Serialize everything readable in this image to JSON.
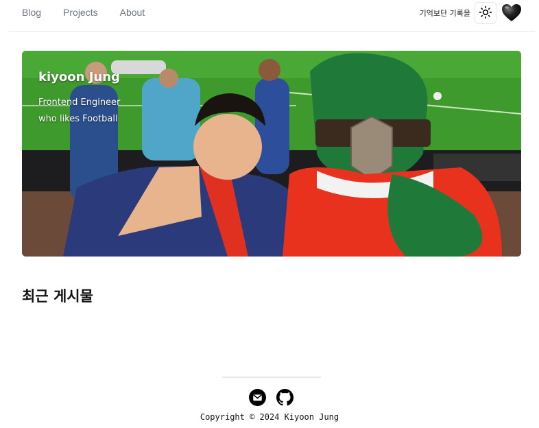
{
  "nav": {
    "items": [
      {
        "label": "Blog"
      },
      {
        "label": "Projects"
      },
      {
        "label": "About"
      }
    ]
  },
  "header": {
    "tagline": "기억보단 기록을"
  },
  "hero": {
    "name": "kiyoon Jung",
    "subtitle_line1": "Frontend Engineer",
    "subtitle_line2": "who likes Football"
  },
  "main": {
    "section_title": "최근 게시물"
  },
  "footer": {
    "copyright": "Copyright © 2024 Kiyoon Jung"
  },
  "icons": {
    "theme": "sun-icon",
    "profile": "heart-icon",
    "mail": "mail-icon",
    "github": "github-icon"
  },
  "colors": {
    "nav_text": "#6b7280",
    "border": "#e5e7eb",
    "pitch_green": "#3a8a2a",
    "mascot_green": "#1f7a3a",
    "shirt_red": "#e8321e"
  }
}
